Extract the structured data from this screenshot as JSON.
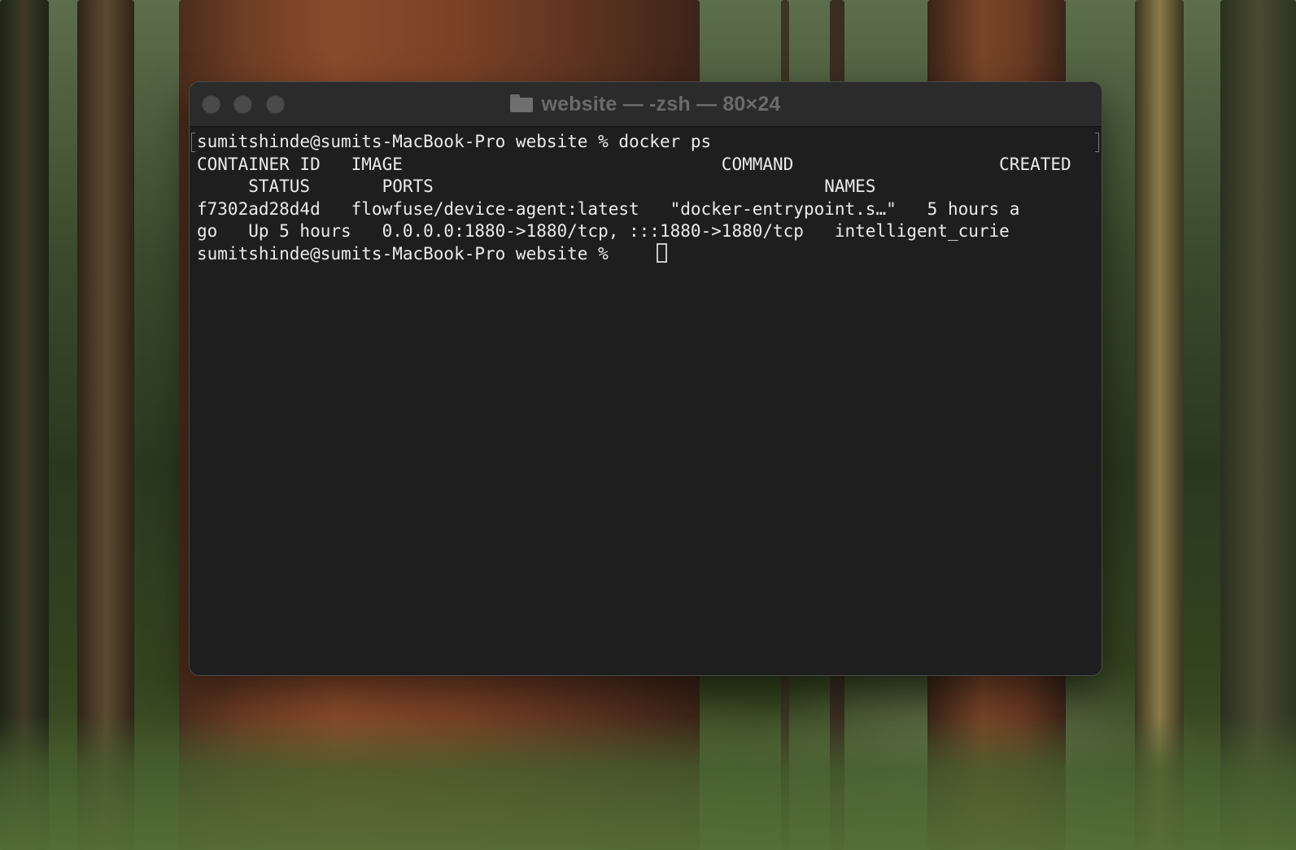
{
  "window": {
    "title": "website — -zsh — 80×24"
  },
  "terminal": {
    "lines": [
      "sumitshinde@sumits-MacBook-Pro website % docker ps",
      "CONTAINER ID   IMAGE                               COMMAND                    CREATED",
      "     STATUS       PORTS                                      NAMES",
      "f7302ad28d4d   flowfuse/device-agent:latest   \"docker-entrypoint.s…\"   5 hours a",
      "go   Up 5 hours   0.0.0.0:1880->1880/tcp, :::1880->1880/tcp   intelligent_curie",
      "sumitshinde@sumits-MacBook-Pro website % "
    ]
  },
  "icons": {
    "title": "folder-icon",
    "buttons": [
      "close-button",
      "minimize-button",
      "zoom-button"
    ]
  },
  "colors": {
    "terminal_background": "#1e1e1e",
    "titlebar_background": "#2b2b2b",
    "text": "#ebebeb",
    "title_text": "#6b6b6b",
    "traffic_light_inactive": "#4a4a4a"
  }
}
